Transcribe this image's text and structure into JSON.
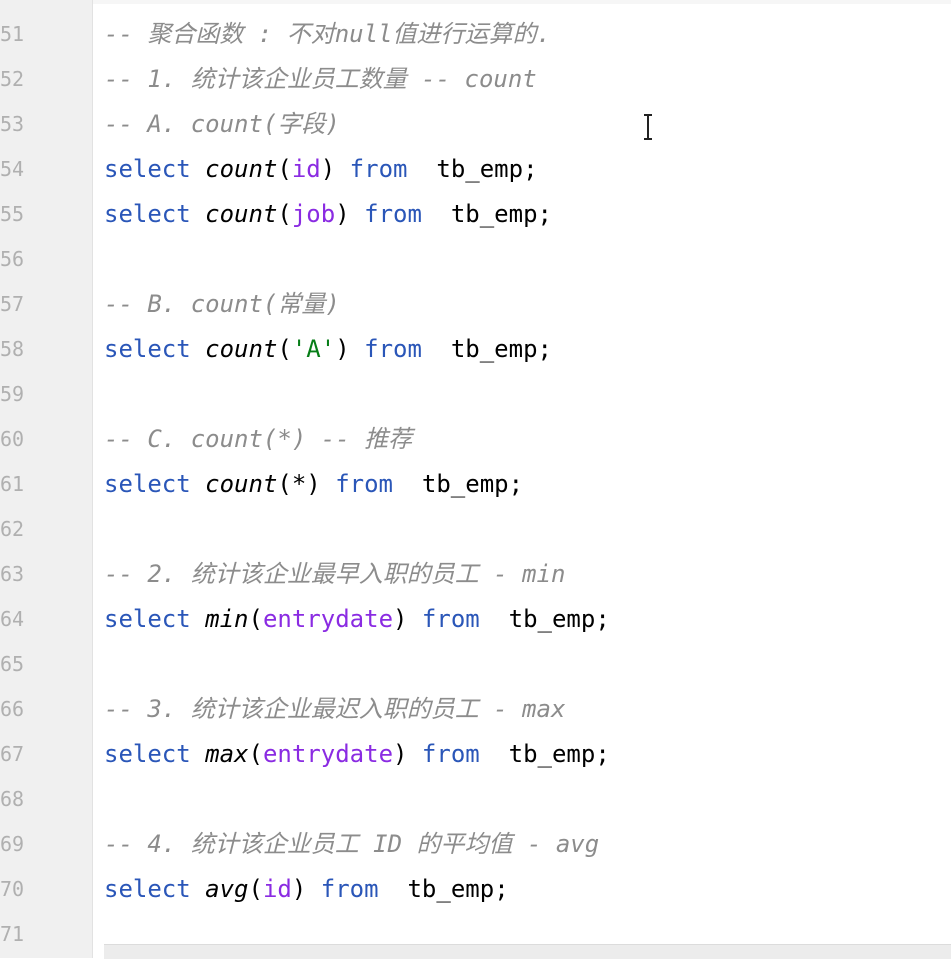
{
  "colors": {
    "keyword": "#2a56b8",
    "column": "#8a2be2",
    "string": "#067d17",
    "comment": "#8c8c8c",
    "gutter_bg": "#f0f0f0",
    "line_number": "#b0b0b0"
  },
  "editor": {
    "lines": [
      {
        "num": "51",
        "tokens": [
          {
            "t": "cm",
            "v": "-- 聚合函数 : 不对null值进行运算的."
          }
        ]
      },
      {
        "num": "52",
        "tokens": [
          {
            "t": "cm",
            "v": "-- 1. 统计该企业员工数量 -- count"
          }
        ]
      },
      {
        "num": "53",
        "tokens": [
          {
            "t": "cm",
            "v": "-- A. count(字段)"
          }
        ]
      },
      {
        "num": "54",
        "tokens": [
          {
            "t": "kw",
            "v": "select"
          },
          {
            "t": "punc",
            "v": " "
          },
          {
            "t": "fn",
            "v": "count"
          },
          {
            "t": "punc",
            "v": "("
          },
          {
            "t": "col",
            "v": "id"
          },
          {
            "t": "punc",
            "v": ") "
          },
          {
            "t": "kw",
            "v": "from"
          },
          {
            "t": "punc",
            "v": "  "
          },
          {
            "t": "tbl",
            "v": "tb_emp"
          },
          {
            "t": "punc",
            "v": ";"
          }
        ]
      },
      {
        "num": "55",
        "tokens": [
          {
            "t": "kw",
            "v": "select"
          },
          {
            "t": "punc",
            "v": " "
          },
          {
            "t": "fn",
            "v": "count"
          },
          {
            "t": "punc",
            "v": "("
          },
          {
            "t": "col",
            "v": "job"
          },
          {
            "t": "punc",
            "v": ") "
          },
          {
            "t": "kw",
            "v": "from"
          },
          {
            "t": "punc",
            "v": "  "
          },
          {
            "t": "tbl",
            "v": "tb_emp"
          },
          {
            "t": "punc",
            "v": ";"
          }
        ]
      },
      {
        "num": "56",
        "tokens": []
      },
      {
        "num": "57",
        "tokens": [
          {
            "t": "cm",
            "v": "-- B. count(常量)"
          }
        ]
      },
      {
        "num": "58",
        "tokens": [
          {
            "t": "kw",
            "v": "select"
          },
          {
            "t": "punc",
            "v": " "
          },
          {
            "t": "fn",
            "v": "count"
          },
          {
            "t": "punc",
            "v": "("
          },
          {
            "t": "str",
            "v": "'A'"
          },
          {
            "t": "punc",
            "v": ") "
          },
          {
            "t": "kw",
            "v": "from"
          },
          {
            "t": "punc",
            "v": "  "
          },
          {
            "t": "tbl",
            "v": "tb_emp"
          },
          {
            "t": "punc",
            "v": ";"
          }
        ]
      },
      {
        "num": "59",
        "tokens": []
      },
      {
        "num": "60",
        "tokens": [
          {
            "t": "cm",
            "v": "-- C. count(*) -- 推荐"
          }
        ]
      },
      {
        "num": "61",
        "tokens": [
          {
            "t": "kw",
            "v": "select"
          },
          {
            "t": "punc",
            "v": " "
          },
          {
            "t": "fn",
            "v": "count"
          },
          {
            "t": "punc",
            "v": "(*) "
          },
          {
            "t": "kw",
            "v": "from"
          },
          {
            "t": "punc",
            "v": "  "
          },
          {
            "t": "tbl",
            "v": "tb_emp"
          },
          {
            "t": "punc",
            "v": ";"
          }
        ]
      },
      {
        "num": "62",
        "tokens": []
      },
      {
        "num": "63",
        "tokens": [
          {
            "t": "cm",
            "v": "-- 2. 统计该企业最早入职的员工 - min"
          }
        ]
      },
      {
        "num": "64",
        "tokens": [
          {
            "t": "kw",
            "v": "select"
          },
          {
            "t": "punc",
            "v": " "
          },
          {
            "t": "fn",
            "v": "min"
          },
          {
            "t": "punc",
            "v": "("
          },
          {
            "t": "col",
            "v": "entrydate"
          },
          {
            "t": "punc",
            "v": ") "
          },
          {
            "t": "kw",
            "v": "from"
          },
          {
            "t": "punc",
            "v": "  "
          },
          {
            "t": "tbl",
            "v": "tb_emp"
          },
          {
            "t": "punc",
            "v": ";"
          }
        ]
      },
      {
        "num": "65",
        "tokens": []
      },
      {
        "num": "66",
        "tokens": [
          {
            "t": "cm",
            "v": "-- 3. 统计该企业最迟入职的员工 - max"
          }
        ]
      },
      {
        "num": "67",
        "tokens": [
          {
            "t": "kw",
            "v": "select"
          },
          {
            "t": "punc",
            "v": " "
          },
          {
            "t": "fn",
            "v": "max"
          },
          {
            "t": "punc",
            "v": "("
          },
          {
            "t": "col",
            "v": "entrydate"
          },
          {
            "t": "punc",
            "v": ") "
          },
          {
            "t": "kw",
            "v": "from"
          },
          {
            "t": "punc",
            "v": "  "
          },
          {
            "t": "tbl",
            "v": "tb_emp"
          },
          {
            "t": "punc",
            "v": ";"
          }
        ]
      },
      {
        "num": "68",
        "tokens": []
      },
      {
        "num": "69",
        "tokens": [
          {
            "t": "cm",
            "v": "-- 4. 统计该企业员工 ID 的平均值 - avg"
          }
        ]
      },
      {
        "num": "70",
        "tokens": [
          {
            "t": "kw",
            "v": "select"
          },
          {
            "t": "punc",
            "v": " "
          },
          {
            "t": "fn",
            "v": "avg"
          },
          {
            "t": "punc",
            "v": "("
          },
          {
            "t": "col",
            "v": "id"
          },
          {
            "t": "punc",
            "v": ") "
          },
          {
            "t": "kw",
            "v": "from"
          },
          {
            "t": "punc",
            "v": "  "
          },
          {
            "t": "tbl",
            "v": "tb_emp"
          },
          {
            "t": "punc",
            "v": ";"
          }
        ]
      },
      {
        "num": "71",
        "tokens": []
      }
    ],
    "cursor_icon": "text-cursor-icon"
  }
}
